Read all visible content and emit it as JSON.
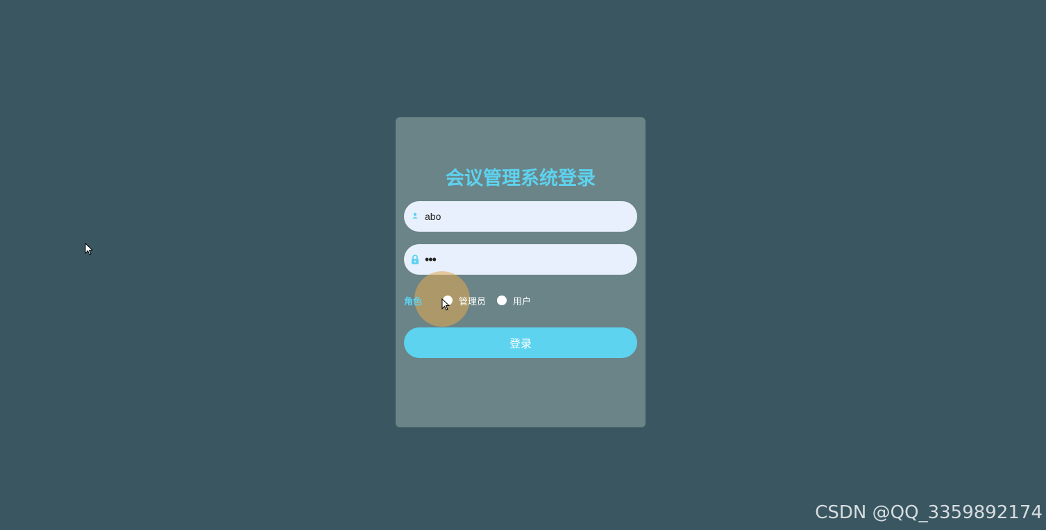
{
  "login": {
    "title": "会议管理系统登录",
    "username_value": "abo",
    "password_value": "•••",
    "role_label": "角色",
    "roles": [
      {
        "label": "管理员",
        "selected": false
      },
      {
        "label": "用户",
        "selected": false
      }
    ],
    "submit_label": "登录"
  },
  "watermark": "CSDN @QQ_3359892174",
  "colors": {
    "background": "#3a5761",
    "card": "#6b8487",
    "accent": "#5dd3f0",
    "input_bg": "#e7f0fc"
  },
  "icons": {
    "username": "user-icon",
    "password": "lock-icon"
  }
}
